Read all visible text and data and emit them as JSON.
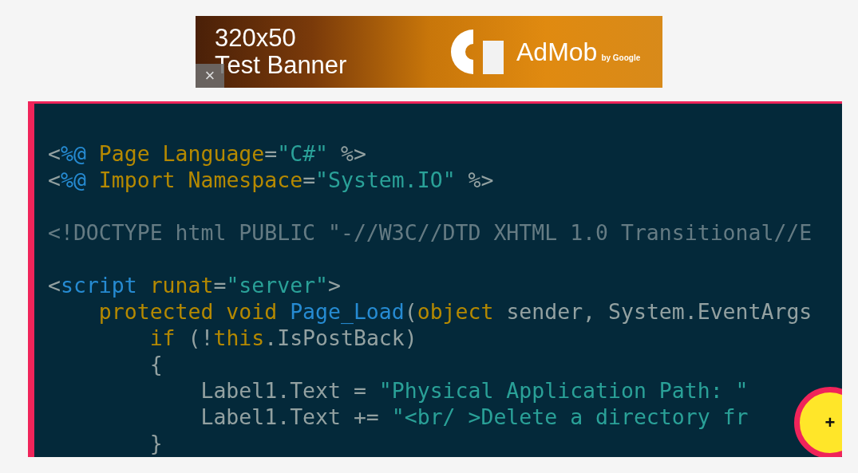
{
  "ad_banner": {
    "size_text": "320x50",
    "title": "Test Banner",
    "brand": "AdMob",
    "byline": "by Google",
    "close": "×"
  },
  "code_blocks": [
    {
      "lines": [
        [
          {
            "text": "<",
            "kind": "plain"
          },
          {
            "text": "%@",
            "kind": "tag"
          },
          {
            "text": " Page Language",
            "kind": "keyword"
          },
          {
            "text": "=",
            "kind": "plain"
          },
          {
            "text": "\"C#\"",
            "kind": "string"
          },
          {
            "text": " %>",
            "kind": "plain"
          }
        ],
        [
          {
            "text": "<",
            "kind": "plain"
          },
          {
            "text": "%@",
            "kind": "tag"
          },
          {
            "text": " Import Namespace",
            "kind": "keyword"
          },
          {
            "text": "=",
            "kind": "plain"
          },
          {
            "text": "\"System.IO\"",
            "kind": "string"
          },
          {
            "text": " %>",
            "kind": "plain"
          }
        ]
      ]
    },
    {
      "lines": [
        [
          {
            "text": "<!DOCTYPE html PUBLIC \"-//W3C//DTD XHTML 1.0 Transitional//E",
            "kind": "doctype"
          }
        ]
      ]
    },
    {
      "lines": [
        [
          {
            "text": "<",
            "kind": "plain"
          },
          {
            "text": "script",
            "kind": "tag"
          },
          {
            "text": " runat",
            "kind": "keyword"
          },
          {
            "text": "=",
            "kind": "plain"
          },
          {
            "text": "\"server\"",
            "kind": "string"
          },
          {
            "text": ">",
            "kind": "plain"
          }
        ],
        [
          {
            "text": "    protected void ",
            "kind": "keyword"
          },
          {
            "text": "Page_Load",
            "kind": "tag"
          },
          {
            "text": "(",
            "kind": "plain"
          },
          {
            "text": "object",
            "kind": "keyword"
          },
          {
            "text": " sender, System.EventArgs",
            "kind": "plain"
          }
        ],
        [
          {
            "text": "        if",
            "kind": "keyword"
          },
          {
            "text": " (!",
            "kind": "plain"
          },
          {
            "text": "this",
            "kind": "keyword"
          },
          {
            "text": ".IsPostBack)",
            "kind": "plain"
          }
        ],
        [
          {
            "text": "        {",
            "kind": "plain"
          }
        ],
        [
          {
            "text": "            Label1.Text = ",
            "kind": "plain"
          },
          {
            "text": "\"Physical Application Path: \"",
            "kind": "string"
          }
        ],
        [
          {
            "text": "            Label1.Text += ",
            "kind": "plain"
          },
          {
            "text": "\"<br/ >Delete a directory fr",
            "kind": "string"
          }
        ],
        [
          {
            "text": "        }",
            "kind": "plain"
          }
        ]
      ]
    }
  ],
  "fab": {
    "label": "+"
  }
}
